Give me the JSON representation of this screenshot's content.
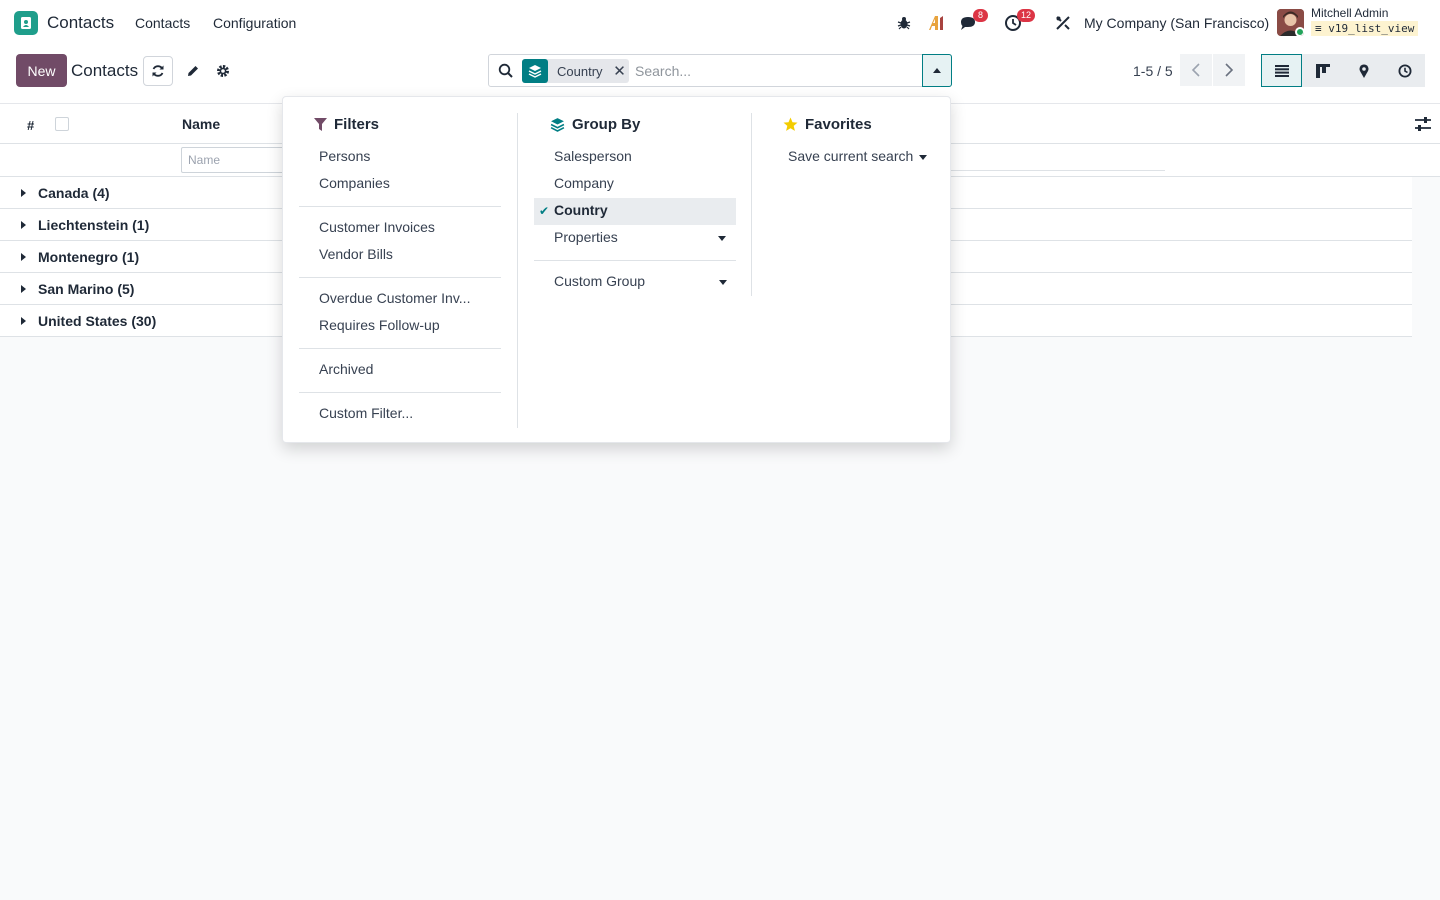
{
  "navbar": {
    "app_name": "Contacts",
    "menus": [
      "Contacts",
      "Configuration"
    ],
    "messages_count": "8",
    "activities_count": "12",
    "company": "My Company (San Francisco)",
    "user_name": "Mitchell Admin",
    "database": "v19_list_view"
  },
  "control": {
    "new_label": "New",
    "title": "Contacts",
    "facet_label": "Country",
    "search_placeholder": "Search...",
    "pager": "1-5 / 5"
  },
  "list": {
    "col_hash": "#",
    "col_name": "Name",
    "name_filter_placeholder": "Name",
    "groups": [
      "Canada (4)",
      "Liechtenstein (1)",
      "Montenegro (1)",
      "San Marino (5)",
      "United States (30)"
    ]
  },
  "dropdown": {
    "filters": {
      "title": "Filters",
      "items": [
        "Persons",
        "Companies",
        "Customer Invoices",
        "Vendor Bills",
        "Overdue Customer Inv...",
        "Requires Follow-up",
        "Archived",
        "Custom Filter..."
      ]
    },
    "group_by": {
      "title": "Group By",
      "items": [
        "Salesperson",
        "Company",
        "Country",
        "Properties",
        "Custom Group"
      ],
      "selected": "Country"
    },
    "favorites": {
      "title": "Favorites",
      "save_label": "Save current search"
    }
  },
  "colors": {
    "brand": "#714b67",
    "accent": "#017e84",
    "badge": "#dc3545"
  }
}
